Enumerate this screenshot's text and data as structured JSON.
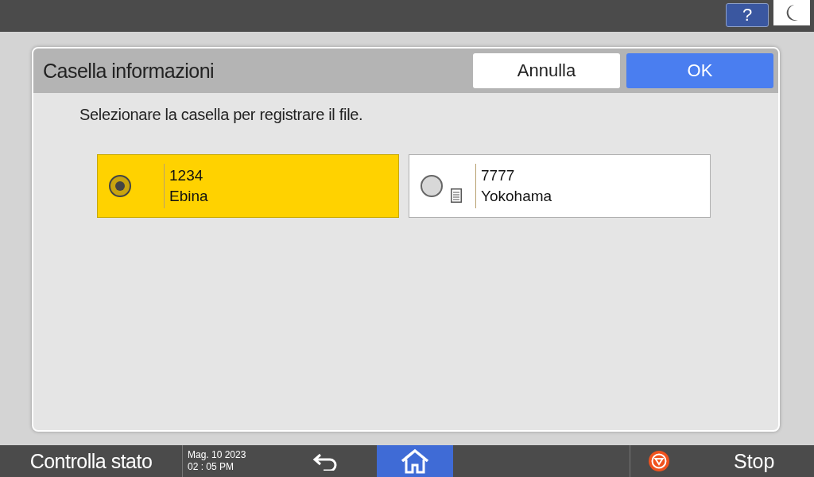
{
  "top_bar": {
    "help_button": "?"
  },
  "dialog": {
    "title": "Casella informazioni",
    "buttons": [
      {
        "label": "Annulla",
        "kind": "cancel"
      },
      {
        "label": "OK",
        "kind": "primary"
      }
    ],
    "instruction": "Selezionare la casella per registrare il file.",
    "boxes": [
      {
        "number": "1234",
        "name": "Ebina",
        "selected": true,
        "has_document": false
      },
      {
        "number": "7777",
        "name": "Yokohama",
        "selected": false,
        "has_document": true
      }
    ]
  },
  "bottom_bar": {
    "status_button": "Controlla stato",
    "date": "Mag. 10 2023",
    "time": "02 : 05 PM",
    "home_selected": true,
    "stop_button": "Stop"
  }
}
